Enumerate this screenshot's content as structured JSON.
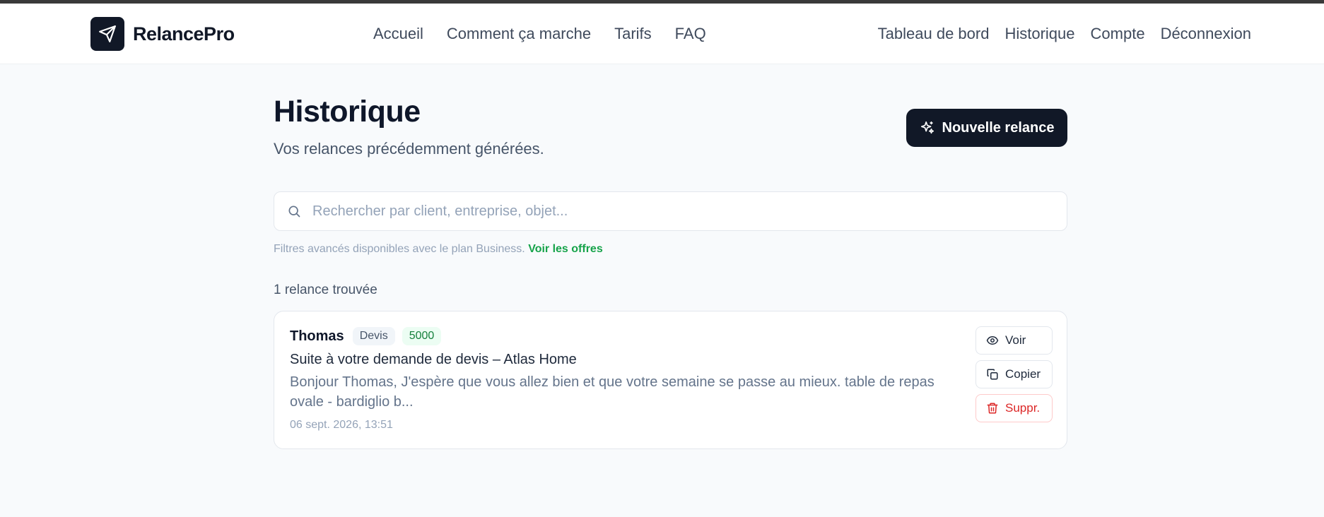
{
  "app": {
    "name": "RelancePro"
  },
  "nav": {
    "center": [
      "Accueil",
      "Comment ça marche",
      "Tarifs",
      "FAQ"
    ],
    "right": [
      "Tableau de bord",
      "Historique",
      "Compte",
      "Déconnexion"
    ]
  },
  "page": {
    "title": "Historique",
    "subtitle": "Vos relances précédemment générées.",
    "new_button": "Nouvelle relance"
  },
  "search": {
    "placeholder": "Rechercher par client, entreprise, objet..."
  },
  "filters": {
    "note": "Filtres avancés disponibles avec le plan Business.",
    "link": "Voir les offres"
  },
  "results": {
    "count_label": "1 relance trouvée",
    "items": [
      {
        "client": "Thomas",
        "type": "Devis",
        "amount": "5000",
        "subject": "Suite à votre demande de devis – Atlas Home",
        "excerpt": "Bonjour Thomas, J'espère que vous allez bien et que votre semaine se passe au mieux. table de repas ovale - bardiglio b...",
        "date": "06 sept. 2026, 13:51",
        "actions": {
          "view": "Voir",
          "copy": "Copier",
          "delete": "Suppr."
        }
      }
    ]
  },
  "icons": {
    "logo": "paper-plane-icon",
    "new": "sparkles-icon",
    "search": "search-icon",
    "view": "eye-icon",
    "copy": "copy-icon",
    "delete": "trash-icon"
  },
  "colors": {
    "primary": "#111827",
    "accent_green": "#16a34a",
    "danger": "#dc2626",
    "background": "#f8fafc"
  }
}
